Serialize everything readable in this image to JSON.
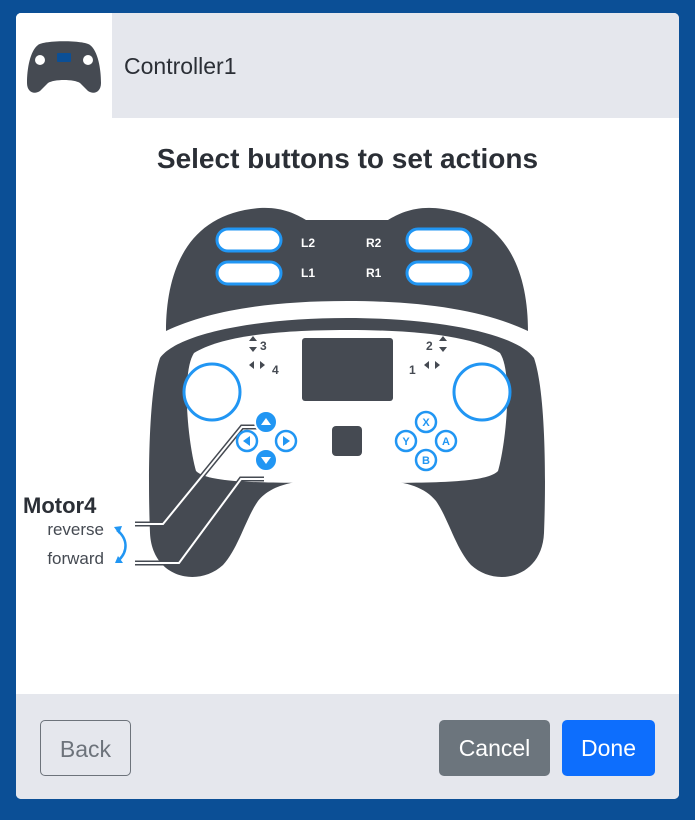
{
  "header": {
    "title": "Controller1",
    "icon": "gamepad-icon"
  },
  "heading": "Select buttons to set actions",
  "controller": {
    "bumpers": {
      "l2": "L2",
      "r2": "R2",
      "l1": "L1",
      "r1": "R1"
    },
    "axis_labels": {
      "axis3": "3",
      "axis4": "4",
      "axis2": "2",
      "axis1": "1"
    },
    "face_buttons": {
      "x": "X",
      "a": "A",
      "b": "B",
      "y": "Y"
    },
    "accent_color": "#2196f3",
    "body_color": "#454a52"
  },
  "motor": {
    "name": "Motor4",
    "reverse_label": "reverse",
    "forward_label": "forward"
  },
  "footer": {
    "back_label": "Back",
    "cancel_label": "Cancel",
    "done_label": "Done"
  }
}
